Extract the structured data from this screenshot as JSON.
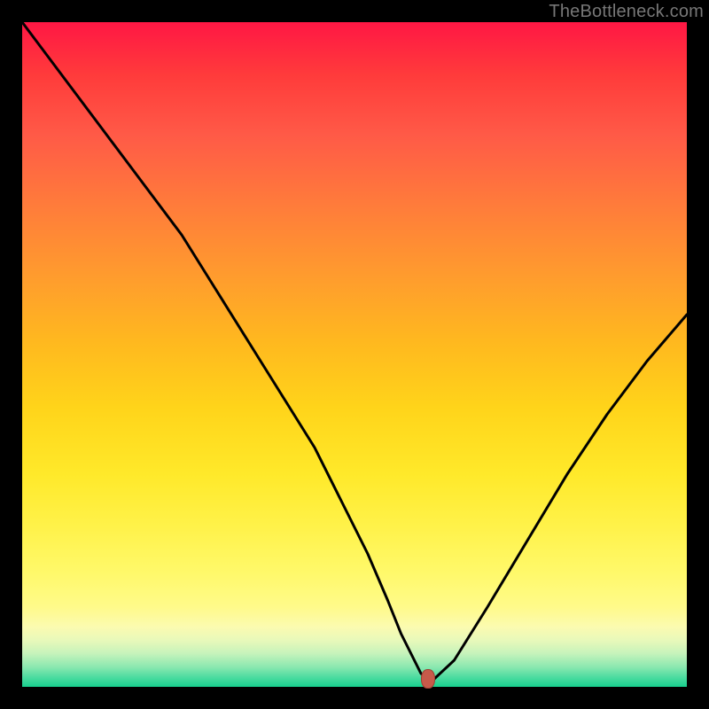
{
  "watermark": "TheBottleneck.com",
  "chart_data": {
    "type": "line",
    "title": "",
    "xlabel": "",
    "ylabel": "",
    "xlim": [
      0,
      100
    ],
    "ylim": [
      0,
      100
    ],
    "grid": false,
    "legend": false,
    "series": [
      {
        "name": "bottleneck-curve",
        "x": [
          0,
          6,
          12,
          18,
          24,
          29,
          34,
          39,
          44,
          48,
          52,
          55,
          57,
          59,
          60,
          61,
          62,
          65,
          70,
          76,
          82,
          88,
          94,
          100
        ],
        "y": [
          100,
          92,
          84,
          76,
          68,
          60,
          52,
          44,
          36,
          28,
          20,
          13,
          8,
          4,
          2,
          1.2,
          1.2,
          4,
          12,
          22,
          32,
          41,
          49,
          56
        ]
      }
    ],
    "marker": {
      "x": 61,
      "y": 1.2,
      "color": "#c75a4a"
    },
    "gradient_stops": [
      {
        "pct": 0,
        "color": "#ff1744"
      },
      {
        "pct": 8,
        "color": "#ff3b3b"
      },
      {
        "pct": 17,
        "color": "#ff5a47"
      },
      {
        "pct": 28,
        "color": "#ff7d3a"
      },
      {
        "pct": 38,
        "color": "#ff9b2e"
      },
      {
        "pct": 48,
        "color": "#ffb81f"
      },
      {
        "pct": 58,
        "color": "#ffd41a"
      },
      {
        "pct": 68,
        "color": "#ffe92a"
      },
      {
        "pct": 76,
        "color": "#fff24a"
      },
      {
        "pct": 83,
        "color": "#fff96b"
      },
      {
        "pct": 88,
        "color": "#fffa8a"
      },
      {
        "pct": 91,
        "color": "#fbfbb0"
      },
      {
        "pct": 93,
        "color": "#e8f9ba"
      },
      {
        "pct": 95,
        "color": "#c6f3bb"
      },
      {
        "pct": 97,
        "color": "#8be8b0"
      },
      {
        "pct": 98.5,
        "color": "#4fdca1"
      },
      {
        "pct": 100,
        "color": "#18cf8e"
      }
    ]
  }
}
